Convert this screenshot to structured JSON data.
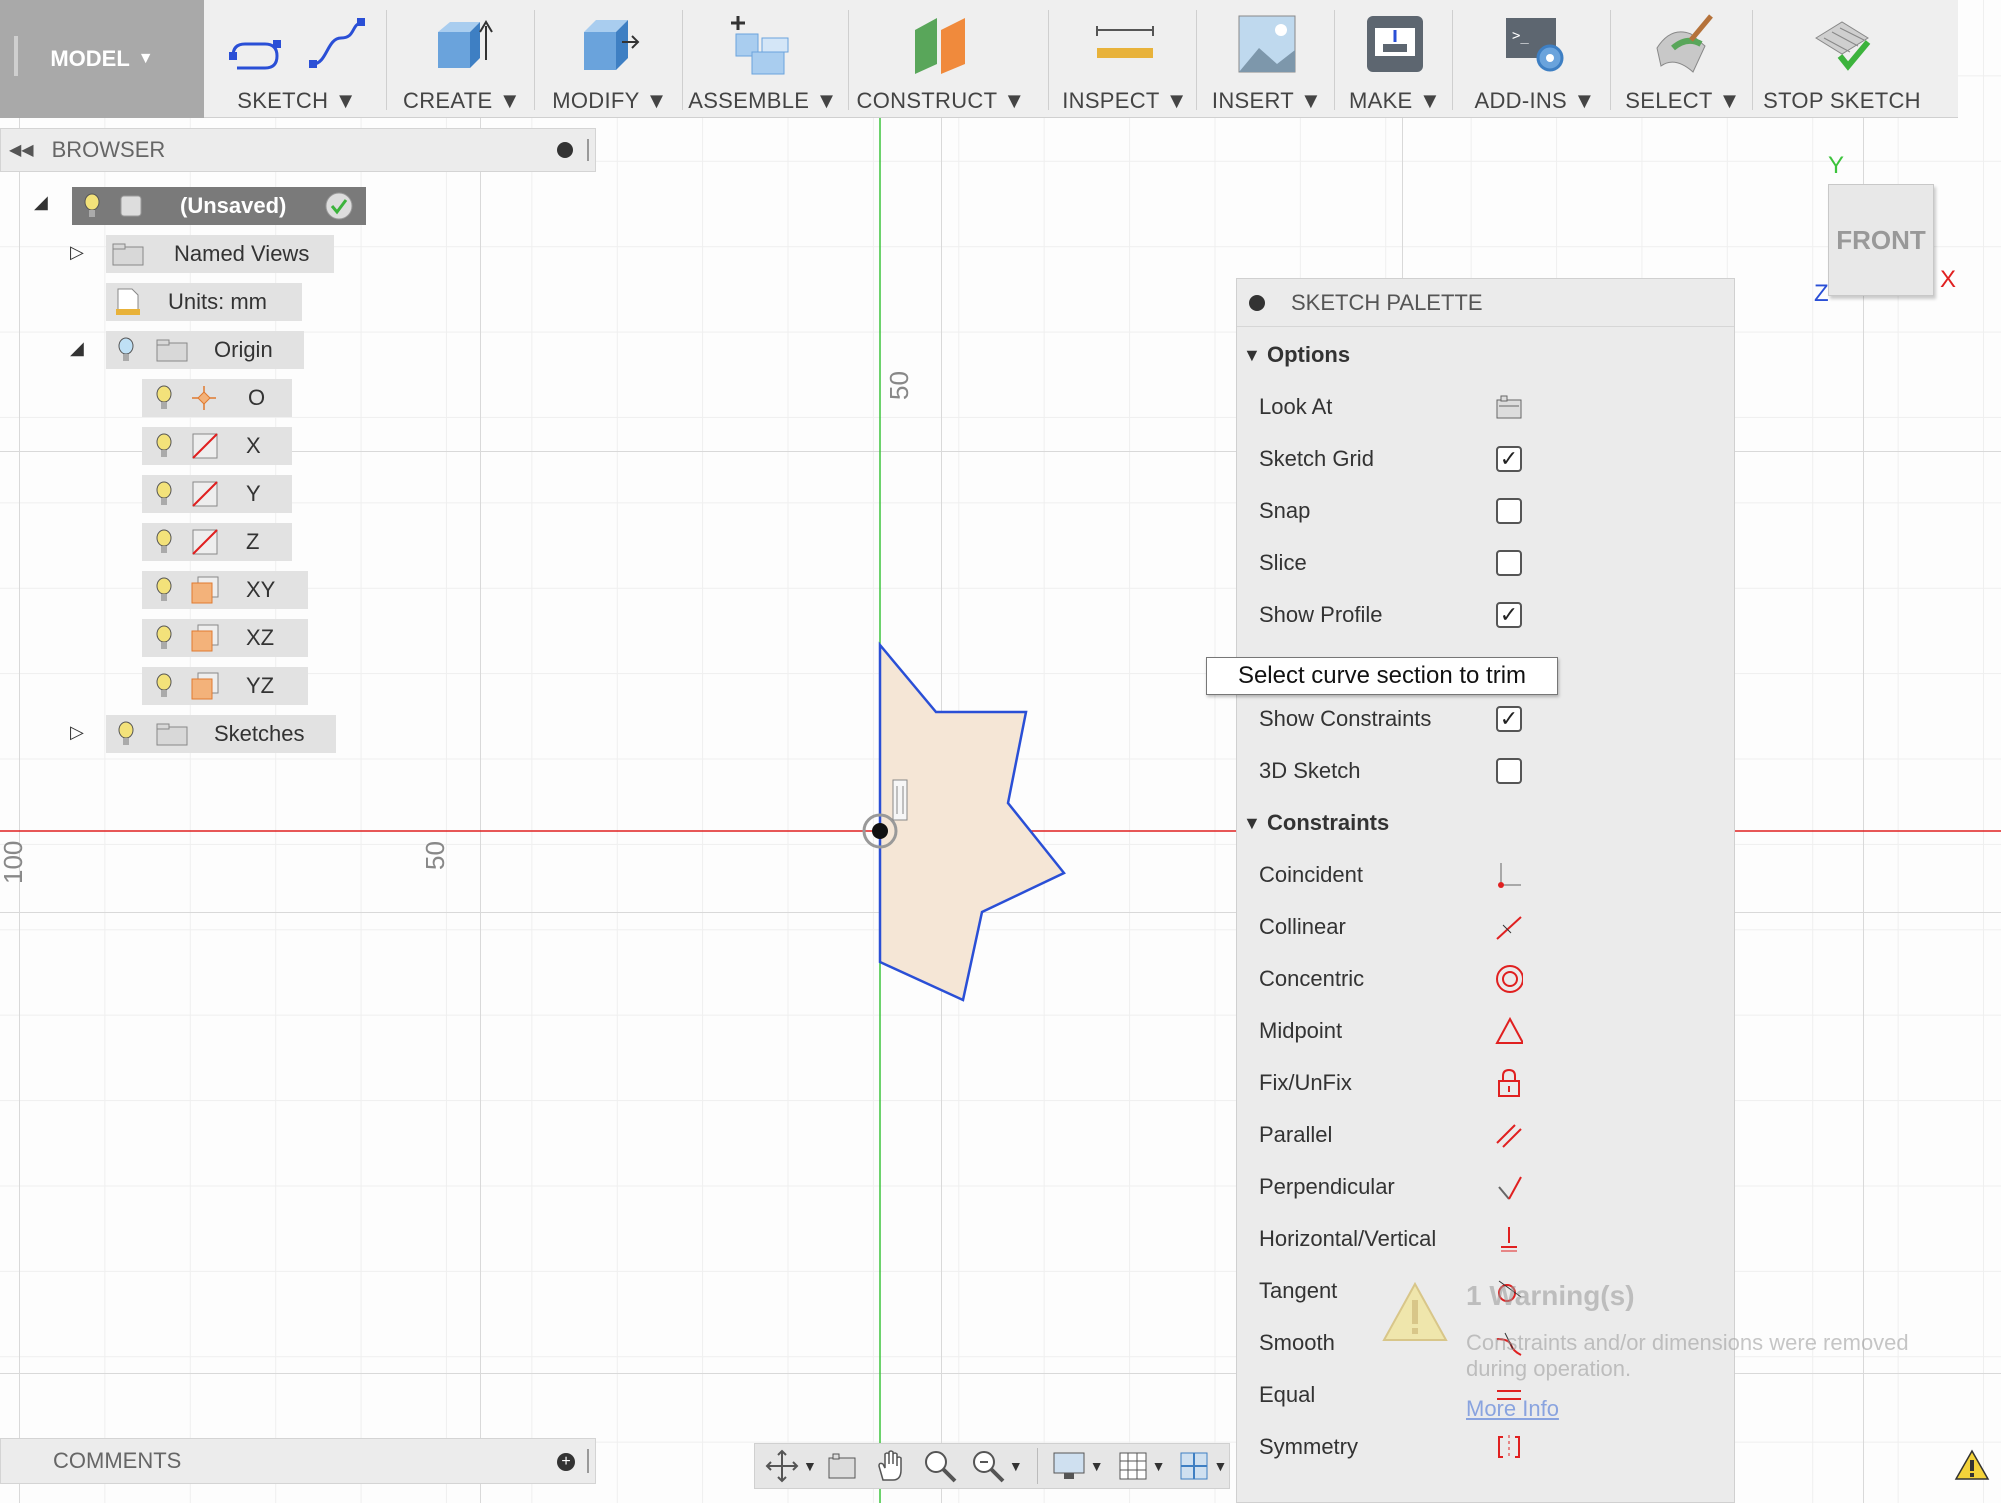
{
  "toolbar": {
    "model": "MODEL",
    "groups": [
      {
        "label": "SKETCH"
      },
      {
        "label": "CREATE"
      },
      {
        "label": "MODIFY"
      },
      {
        "label": "ASSEMBLE"
      },
      {
        "label": "CONSTRUCT"
      },
      {
        "label": "INSPECT"
      },
      {
        "label": "INSERT"
      },
      {
        "label": "MAKE"
      },
      {
        "label": "ADD-INS"
      },
      {
        "label": "SELECT"
      },
      {
        "label": "STOP SKETCH"
      }
    ]
  },
  "browser": {
    "title": "BROWSER",
    "root": "(Unsaved)",
    "named_views": "Named Views",
    "units": "Units: mm",
    "origin": "Origin",
    "origin_items": [
      "O",
      "X",
      "Y",
      "Z",
      "XY",
      "XZ",
      "YZ"
    ],
    "sketches": "Sketches"
  },
  "canvas": {
    "label_50_vertical": "50",
    "label_50_horizontal": "50",
    "label_100": "100"
  },
  "viewcube": {
    "face": "FRONT",
    "axis_y": "Y",
    "axis_x": "X",
    "axis_z": "Z"
  },
  "palette": {
    "title": "SKETCH PALETTE",
    "options_title": "Options",
    "options": [
      {
        "label": "Look At",
        "control": "icon"
      },
      {
        "label": "Sketch Grid",
        "checked": true
      },
      {
        "label": "Snap",
        "checked": false
      },
      {
        "label": "Slice",
        "checked": false
      },
      {
        "label": "Show Profile",
        "checked": true
      },
      {
        "label": "Show Constraints",
        "checked": true
      },
      {
        "label": "3D Sketch",
        "checked": false
      }
    ],
    "constraints_title": "Constraints",
    "constraints": [
      {
        "label": "Coincident",
        "icon": "coincident-icon"
      },
      {
        "label": "Collinear",
        "icon": "collinear-icon"
      },
      {
        "label": "Concentric",
        "icon": "concentric-icon"
      },
      {
        "label": "Midpoint",
        "icon": "midpoint-icon"
      },
      {
        "label": "Fix/UnFix",
        "icon": "lock-icon"
      },
      {
        "label": "Parallel",
        "icon": "parallel-icon"
      },
      {
        "label": "Perpendicular",
        "icon": "perpendicular-icon"
      },
      {
        "label": "Horizontal/Vertical",
        "icon": "horizontal-vertical-icon"
      },
      {
        "label": "Tangent",
        "icon": "tangent-icon"
      },
      {
        "label": "Smooth",
        "icon": "smooth-icon"
      },
      {
        "label": "Equal",
        "icon": "equal-icon"
      },
      {
        "label": "Symmetry",
        "icon": "symmetry-icon"
      }
    ]
  },
  "tooltip": "Select curve section to trim",
  "warning": {
    "title": "1 Warning(s)",
    "message": "Constraints and/or dimensions were removed during operation.",
    "link": "More Info"
  },
  "comments": "COMMENTS",
  "colors": {
    "accent_red": "#e02020",
    "axis_green": "#3cc33c",
    "sketch_blue": "#2a4fd6",
    "profile_fill": "#f5e6d6"
  }
}
